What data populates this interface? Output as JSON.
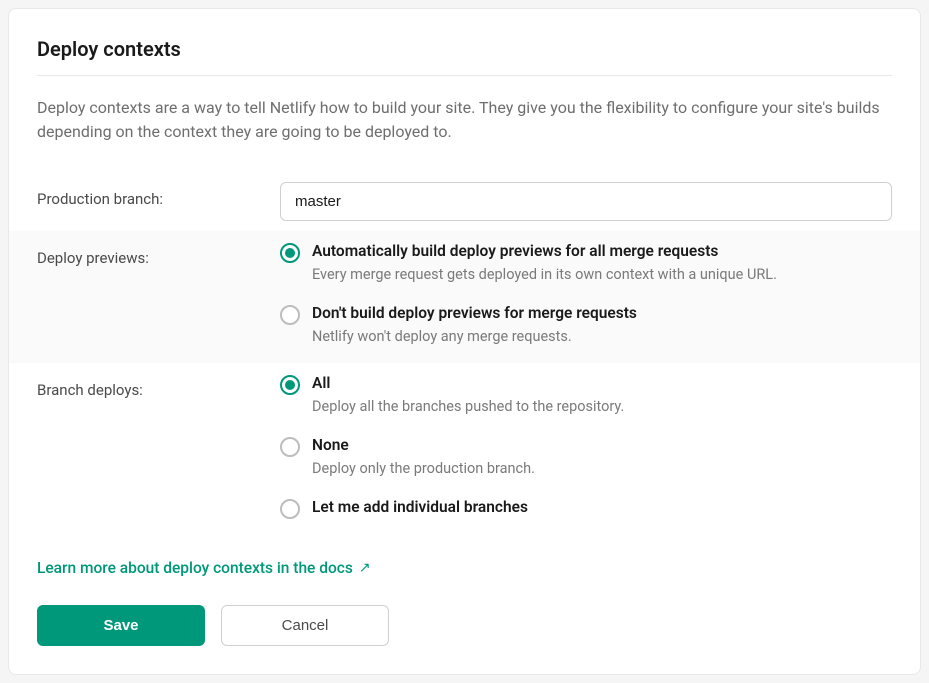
{
  "title": "Deploy contexts",
  "description": "Deploy contexts are a way to tell Netlify how to build your site. They give you the flexibility to configure your site's builds depending on the context they are going to be deployed to.",
  "form": {
    "production_branch": {
      "label": "Production branch:",
      "value": "master"
    },
    "deploy_previews": {
      "label": "Deploy previews:",
      "selected": 0,
      "options": [
        {
          "title": "Automatically build deploy previews for all merge requests",
          "desc": "Every merge request gets deployed in its own context with a unique URL."
        },
        {
          "title": "Don't build deploy previews for merge requests",
          "desc": "Netlify won't deploy any merge requests."
        }
      ]
    },
    "branch_deploys": {
      "label": "Branch deploys:",
      "selected": 0,
      "options": [
        {
          "title": "All",
          "desc": "Deploy all the branches pushed to the repository."
        },
        {
          "title": "None",
          "desc": "Deploy only the production branch."
        },
        {
          "title": "Let me add individual branches",
          "desc": ""
        }
      ]
    }
  },
  "docs_link": "Learn more about deploy contexts in the docs",
  "buttons": {
    "save": "Save",
    "cancel": "Cancel"
  },
  "colors": {
    "accent": "#00987a"
  }
}
